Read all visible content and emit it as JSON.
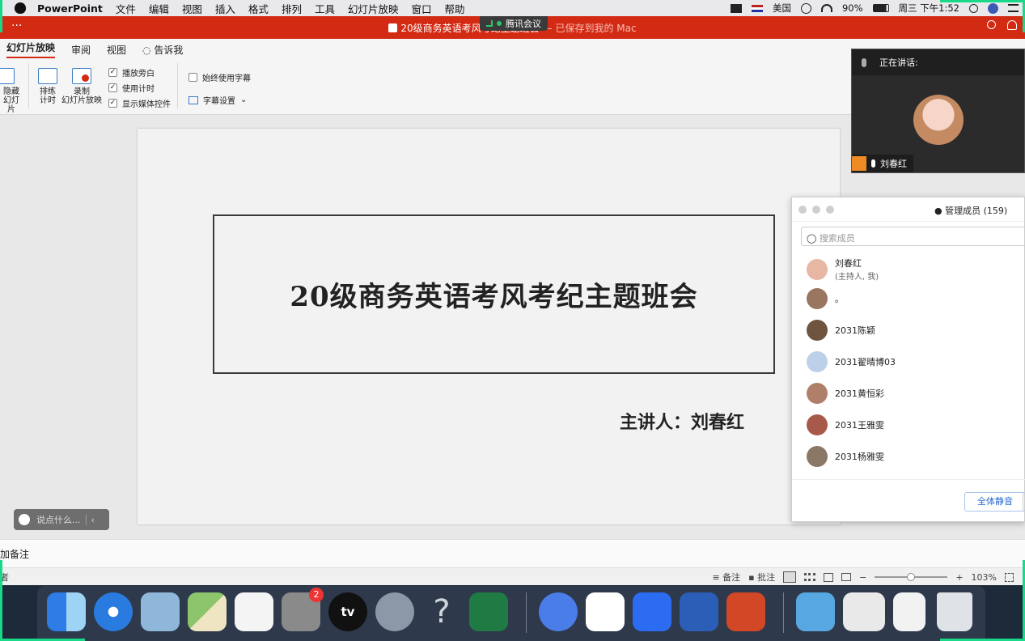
{
  "menubar": {
    "app": "PowerPoint",
    "items": [
      "文件",
      "编辑",
      "视图",
      "插入",
      "格式",
      "排列",
      "工具",
      "幻灯片放映",
      "窗口",
      "帮助"
    ],
    "input_source": "美国",
    "battery": "90%",
    "clock": "周三 下午1:52"
  },
  "meeting_indicator": "腾讯会议",
  "titlebar": {
    "dots": "···",
    "title": "20级商务英语考风考纪主题班会",
    "saved": "— 已保存到我的 Mac"
  },
  "ribbon": {
    "tabs": [
      "幻灯片放映",
      "审阅",
      "视图",
      "告诉我"
    ],
    "hide_slide": [
      "隐藏",
      "幻灯片"
    ],
    "rehearse": [
      "排练",
      "计时"
    ],
    "record": [
      "录制",
      "幻灯片放映"
    ],
    "checks": [
      {
        "label": "播放旁白",
        "checked": true
      },
      {
        "label": "使用计时",
        "checked": true
      },
      {
        "label": "显示媒体控件",
        "checked": true
      }
    ],
    "subtitle_check": {
      "label": "始终使用字幕",
      "checked": false
    },
    "subtitle_settings": "字幕设置"
  },
  "slide": {
    "title": "20级商务英语考风考纪主题班会",
    "speaker": "主讲人：刘春红"
  },
  "chat_pill": {
    "placeholder": "说点什么..."
  },
  "notes": {
    "placeholder": "添加备注"
  },
  "statusbar": {
    "left": "者",
    "notes_label": "备注",
    "comments_label": "批注",
    "zoom": "103%",
    "minus": "−",
    "plus": "+"
  },
  "video": {
    "speaking_label": "正在讲话:",
    "name": "刘春红"
  },
  "members": {
    "title": "管理成员 (159)",
    "search_placeholder": "搜索成员",
    "list": [
      {
        "name": "刘春红",
        "sub": "(主持人, 我)",
        "color": "#e6b7a2"
      },
      {
        "name": "。",
        "sub": "",
        "color": "#9a7560"
      },
      {
        "name": "2031陈颖",
        "sub": "",
        "color": "#6f5440"
      },
      {
        "name": "2031翟晴博03",
        "sub": "",
        "color": "#bcd0ea"
      },
      {
        "name": "2031黄恒彩",
        "sub": "",
        "color": "#b07f6a"
      },
      {
        "name": "2031王雅雯",
        "sub": "",
        "color": "#a85a4a"
      },
      {
        "name": "2031杨雅雯",
        "sub": "",
        "color": "#8b7766"
      }
    ],
    "mute_all": "全体静音"
  },
  "dock": {
    "apps": [
      {
        "name": "finder-icon",
        "color": "#3b8fe8"
      },
      {
        "name": "safari-icon",
        "color": "#2a7be0"
      },
      {
        "name": "preview-icon",
        "color": "#8fb7d9"
      },
      {
        "name": "maps-icon",
        "color": "#8cc56b"
      },
      {
        "name": "reminders-icon",
        "color": "#f4f4f4"
      },
      {
        "name": "system-preferences-icon",
        "color": "#8a8a8a"
      },
      {
        "name": "apple-tv-icon",
        "color": "#111111"
      },
      {
        "name": "launchpad-icon",
        "color": "#8c97a8"
      },
      {
        "name": "help-icon",
        "color": "#00000000"
      },
      {
        "name": "excel-icon",
        "color": "#1f7a44"
      },
      {
        "name": "feishu-icon",
        "color": "#4a7de8"
      },
      {
        "name": "app-diamond-icon",
        "color": "#ffffff"
      },
      {
        "name": "tencent-meeting-icon",
        "color": "#2b6cf0"
      },
      {
        "name": "word-icon",
        "color": "#2b5fb7"
      },
      {
        "name": "powerpoint-icon",
        "color": "#d24726"
      },
      {
        "name": "downloads-folder-icon",
        "color": "#57a8e0"
      },
      {
        "name": "document-preview-icon",
        "color": "#e9e9e9"
      },
      {
        "name": "screenshot-icon",
        "color": "#f2f2f2"
      },
      {
        "name": "trash-icon",
        "color": "#dfe3e8"
      }
    ],
    "badge": "2",
    "tv_label": "tv",
    "help_glyph": "?"
  }
}
